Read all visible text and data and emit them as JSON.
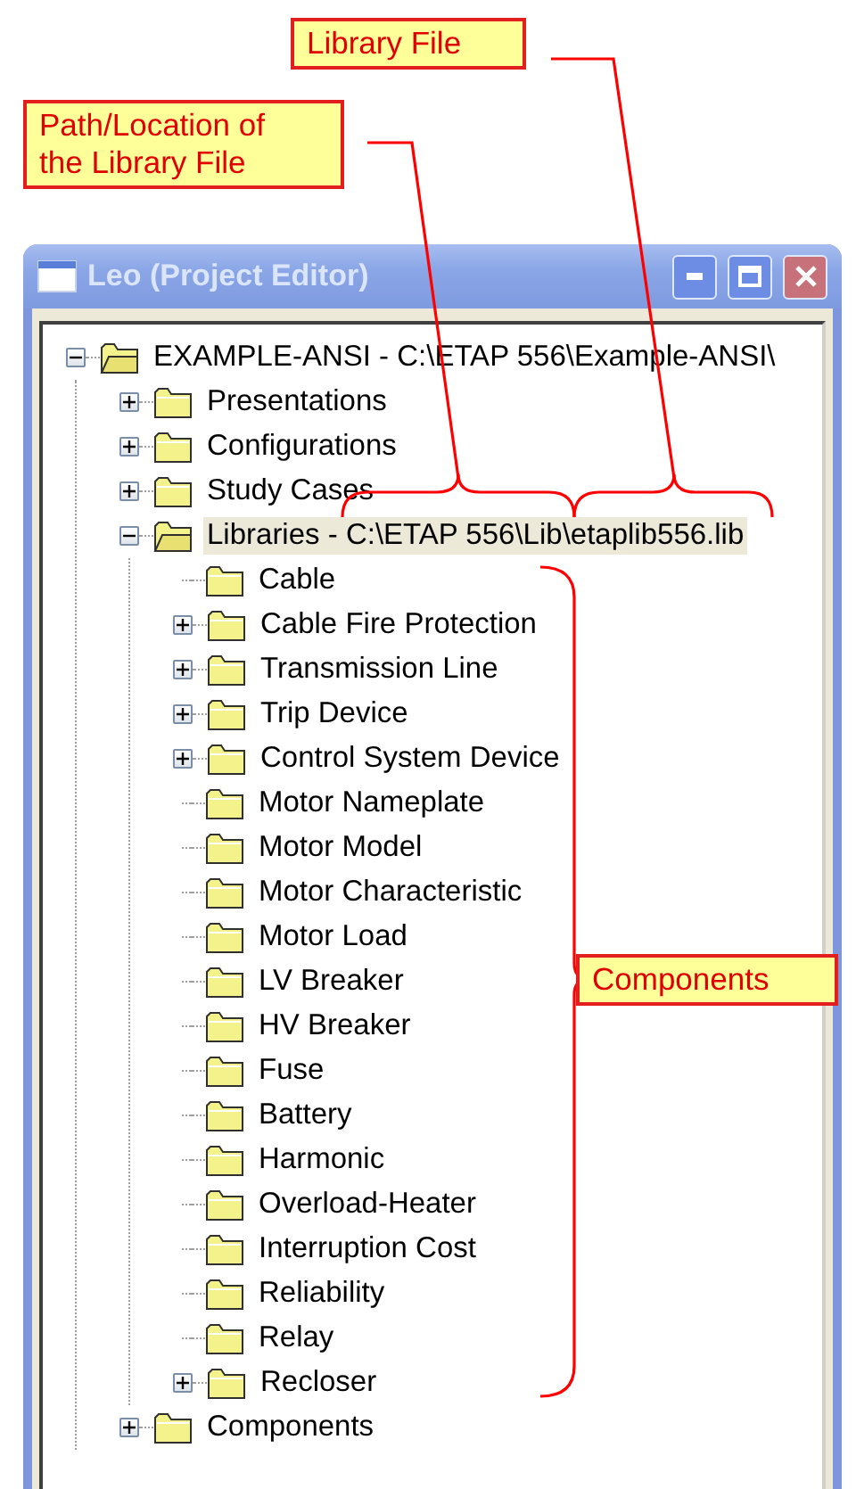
{
  "annotations": [
    {
      "text": "Library File"
    },
    {
      "text": "Path/Location of the Library File"
    },
    {
      "text": "Components"
    }
  ],
  "window": {
    "title": "Leo (Project Editor)"
  },
  "tree": [
    {
      "label": "EXAMPLE-ANSI - C:\\ETAP 556\\Example-ANSI\\",
      "expandable": true,
      "expanded": true,
      "selected": false,
      "children": [
        {
          "label": "Presentations",
          "expandable": true,
          "expanded": false,
          "selected": false
        },
        {
          "label": "Configurations",
          "expandable": true,
          "expanded": false,
          "selected": false
        },
        {
          "label": "Study Cases",
          "expandable": true,
          "expanded": false,
          "selected": false
        },
        {
          "label": "Libraries - C:\\ETAP 556\\Lib\\etaplib556.lib",
          "expandable": true,
          "expanded": true,
          "selected": true,
          "children": [
            {
              "label": "Cable",
              "selected": false
            },
            {
              "label": "Cable Fire Protection",
              "expandable": true,
              "expanded": false,
              "selected": false
            },
            {
              "label": "Transmission Line",
              "expandable": true,
              "expanded": false,
              "selected": false
            },
            {
              "label": "Trip Device",
              "expandable": true,
              "expanded": false,
              "selected": false
            },
            {
              "label": "Control System Device",
              "expandable": true,
              "expanded": false,
              "selected": false
            },
            {
              "label": "Motor Nameplate",
              "selected": false
            },
            {
              "label": "Motor Model",
              "selected": false
            },
            {
              "label": "Motor Characteristic",
              "selected": false
            },
            {
              "label": "Motor Load",
              "selected": false
            },
            {
              "label": "LV Breaker",
              "selected": false
            },
            {
              "label": "HV Breaker",
              "selected": false
            },
            {
              "label": "Fuse",
              "selected": false
            },
            {
              "label": "Battery",
              "selected": false
            },
            {
              "label": "Harmonic",
              "selected": false
            },
            {
              "label": "Overload-Heater",
              "selected": false
            },
            {
              "label": "Interruption Cost",
              "selected": false
            },
            {
              "label": "Reliability",
              "selected": false
            },
            {
              "label": "Relay",
              "selected": false
            },
            {
              "label": "Recloser",
              "expandable": true,
              "expanded": false,
              "selected": false
            }
          ]
        },
        {
          "label": "Components",
          "expandable": true,
          "expanded": false,
          "selected": false
        }
      ]
    }
  ]
}
